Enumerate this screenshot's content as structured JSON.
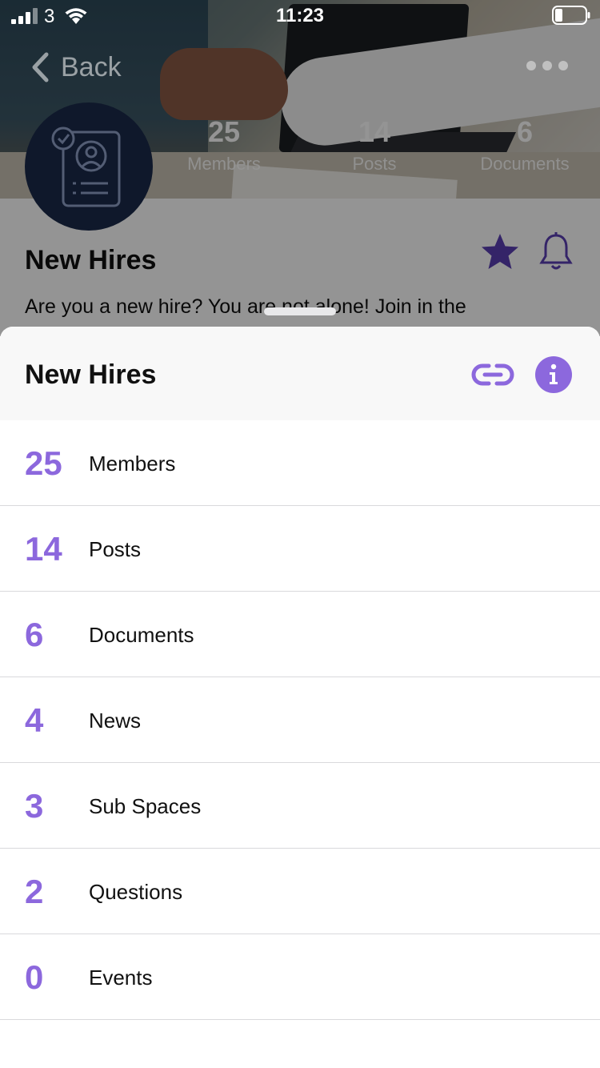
{
  "status_bar": {
    "carrier": "3",
    "time": "11:23"
  },
  "nav": {
    "back_label": "Back"
  },
  "space": {
    "title": "New Hires",
    "description": "Are you a new hire? You are not alone! Join in the",
    "stats": [
      {
        "count": "25",
        "label": "Members"
      },
      {
        "count": "14",
        "label": "Posts"
      },
      {
        "count": "6",
        "label": "Documents"
      }
    ]
  },
  "sheet": {
    "title": "New Hires",
    "items": [
      {
        "count": "25",
        "label": "Members"
      },
      {
        "count": "14",
        "label": "Posts"
      },
      {
        "count": "6",
        "label": "Documents"
      },
      {
        "count": "4",
        "label": "News"
      },
      {
        "count": "3",
        "label": "Sub Spaces"
      },
      {
        "count": "2",
        "label": "Questions"
      },
      {
        "count": "0",
        "label": "Events"
      }
    ]
  },
  "colors": {
    "accent": "#8c68dd",
    "avatar_bg": "#1a2a4a",
    "divider": "#d9d9dc",
    "sheet_header_bg": "#f8f8f8"
  },
  "icons": {
    "back": "chevron-left-icon",
    "more": "more-dots-icon",
    "favorite": "star-icon",
    "notifications": "bell-icon",
    "link": "link-icon",
    "info": "info-icon",
    "avatar": "id-badge-icon"
  }
}
